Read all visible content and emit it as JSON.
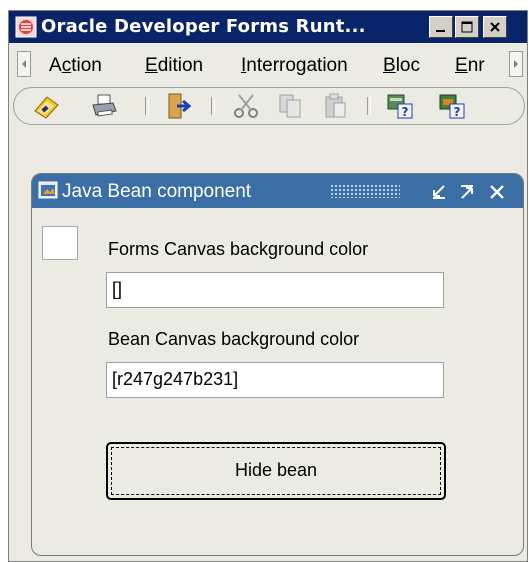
{
  "window": {
    "title": "Oracle Developer Forms Runt..."
  },
  "menu": {
    "items": [
      {
        "label": "Action",
        "mnemonic_index": 1
      },
      {
        "label": "Edition",
        "mnemonic_index": 0
      },
      {
        "label": "Interrogation",
        "mnemonic_index": 0
      },
      {
        "label": "Bloc",
        "mnemonic_index": 0
      },
      {
        "label": "Enr",
        "mnemonic_index": 0
      }
    ]
  },
  "toolbar": {
    "icons": [
      "save-icon",
      "print-icon",
      "exit-icon",
      "cut-icon",
      "copy-icon",
      "paste-icon",
      "query-help-icon",
      "query-help-2-icon"
    ]
  },
  "bean_window": {
    "title": "Java Bean component",
    "forms_canvas_label": "Forms Canvas background color",
    "forms_canvas_value": "[]",
    "bean_canvas_label": "Bean Canvas background color",
    "bean_canvas_value": "[r247g247b231]",
    "hide_button_label": "Hide bean"
  },
  "colors": {
    "titlebar": "#0a246a",
    "inner_titlebar": "#3a6ea5",
    "background": "#ebebe3"
  }
}
